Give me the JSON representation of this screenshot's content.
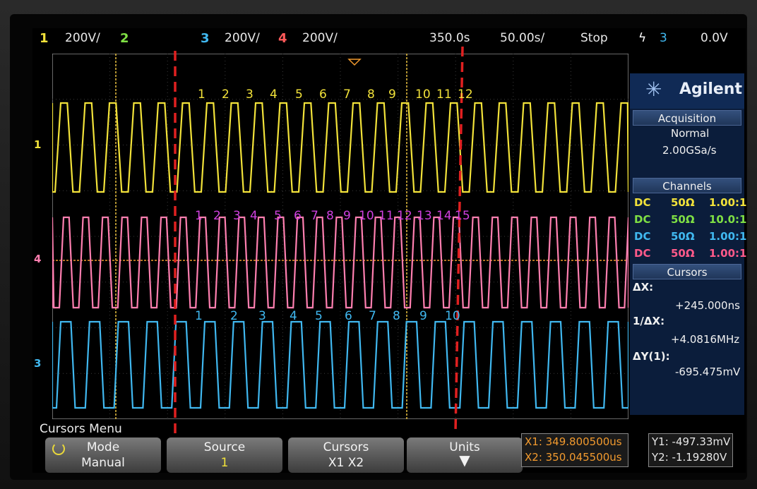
{
  "status_bar": {
    "ch1_num": "1",
    "ch1_scale": "200V/",
    "ch2_num": "2",
    "ch3_num": "3",
    "ch3_scale": "200V/",
    "ch4_num": "4",
    "ch4_scale": "200V/",
    "time_delay": "350.0s",
    "time_div": "50.00s/",
    "run_state": "Stop",
    "trigger_channel": "3",
    "trigger_level": "0.0V"
  },
  "brand": "Agilent",
  "acquisition": {
    "title": "Acquisition",
    "mode": "Normal",
    "rate": "2.00GSa/s"
  },
  "channels": {
    "title": "Channels",
    "rows": [
      {
        "coupling": "DC",
        "impedance": "50Ω",
        "probe": "1.00:1",
        "color": "#f2e23a"
      },
      {
        "coupling": "DC",
        "impedance": "50Ω",
        "probe": "10.0:1",
        "color": "#7fe044"
      },
      {
        "coupling": "DC",
        "impedance": "50Ω",
        "probe": "1.00:1",
        "color": "#40b8f0"
      },
      {
        "coupling": "DC",
        "impedance": "50Ω",
        "probe": "1.00:1",
        "color": "#ff5a8a"
      }
    ]
  },
  "cursors": {
    "title": "Cursors",
    "dx_label": "ΔX:",
    "dx_value": "+245.000ns",
    "inv_dx_label": "1/ΔX:",
    "inv_dx_value": "+4.0816MHz",
    "dy_label": "ΔY(1):",
    "dy_value": "-695.475mV"
  },
  "menu": {
    "title": "Cursors Menu",
    "mode": {
      "label": "Mode",
      "value": "Manual"
    },
    "source": {
      "label": "Source",
      "value": "1"
    },
    "cursors": {
      "label": "Cursors",
      "value": "X1 X2"
    },
    "units": {
      "label": "Units"
    }
  },
  "readouts": {
    "x1": "X1: 349.800500us",
    "x2": "X2: 350.045500us",
    "y1": "Y1: -497.33mV",
    "y2": "Y2: -1.19280V"
  },
  "trace_markers": {
    "ch1": "1",
    "ch4": "4",
    "ch3": "3"
  },
  "annotations": {
    "yellow": [
      "1",
      "2",
      "3",
      "4",
      "5",
      "6",
      "7",
      "8",
      "9",
      "10",
      "11",
      "12"
    ],
    "pink": [
      "1",
      "2",
      "3",
      "4",
      "5",
      "6",
      "7",
      "8",
      "9",
      "10",
      "11",
      "12",
      "13",
      "14",
      "15"
    ],
    "blue": [
      "1",
      "2",
      "3",
      "4",
      "5",
      "6",
      "7",
      "8",
      "9",
      "10"
    ]
  },
  "colors": {
    "ch1": "#f2e23a",
    "ch2": "#7fe044",
    "ch3": "#40b8f0",
    "ch4": "#ff7fb0",
    "cursor_line": "#e02020",
    "annotation_yellow": "#f2e23a",
    "annotation_pink": "#d040e0",
    "annotation_blue": "#40b8f0"
  }
}
